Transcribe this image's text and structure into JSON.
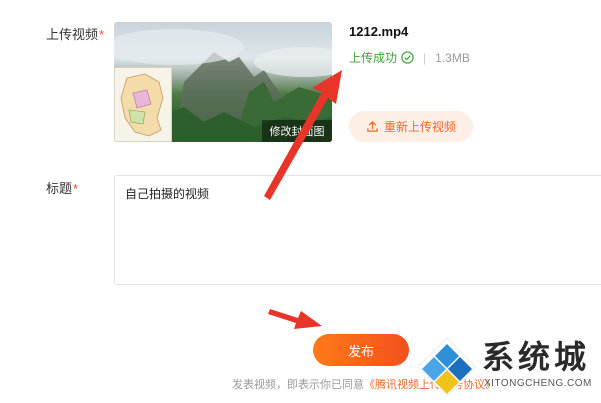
{
  "upload": {
    "label": "上传视频",
    "required_mark": "*",
    "file_name": "1212.mp4",
    "status": "上传成功",
    "separator": "|",
    "size": "1.3MB",
    "edit_cover": "修改封面图",
    "reupload": "重新上传视频"
  },
  "title_field": {
    "label": "标题",
    "required_mark": "*",
    "value": "自己拍摄的视频"
  },
  "actions": {
    "publish": "发布",
    "agreement_prefix": "发表视频，即表示你已同意",
    "agreement_link": "《腾讯视频上传服务协议》"
  },
  "watermark": {
    "text": "系统城",
    "sub": "XITONGCHENG.COM"
  },
  "colors": {
    "accent": "#f26a2b",
    "success": "#3fa23a",
    "annotation_arrow": "#e8352a"
  },
  "icons": [
    "check-circle-icon",
    "upload-icon",
    "watermark-logo-icon"
  ]
}
